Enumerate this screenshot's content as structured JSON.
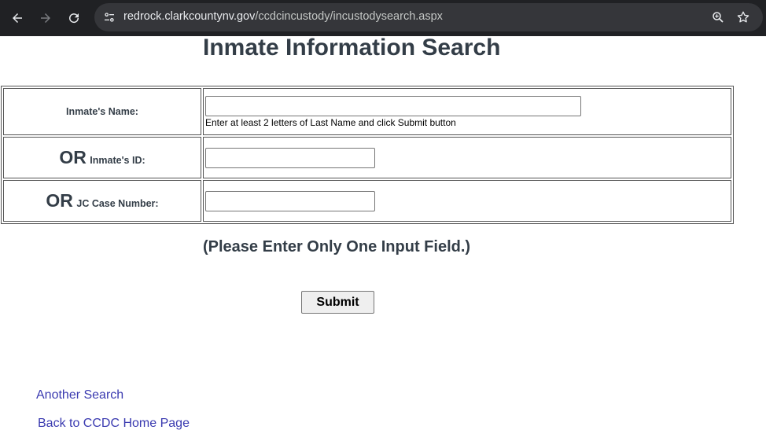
{
  "browser": {
    "url_host": "redrock.clarkcountynv.gov",
    "url_path": "/ccdcincustody/incustodysearch.aspx",
    "icons": [
      "back-icon",
      "forward-icon",
      "reload-icon",
      "site-info-icon",
      "zoom-icon",
      "bookmark-star-icon"
    ]
  },
  "page": {
    "title": "Inmate Information Search",
    "rows": {
      "name_label": "Inmate's Name:",
      "name_value": "",
      "name_hint": "Enter at least 2 letters of Last Name and click Submit button",
      "or_text": "OR",
      "id_label": "Inmate's ID:",
      "id_value": "",
      "case_label": "JC Case Number:",
      "case_value": ""
    },
    "note": "(Please Enter Only One Input Field.)",
    "submit_label": "Submit",
    "links": {
      "another_search": "Another Search",
      "home": "Back to CCDC Home Page"
    }
  },
  "colors": {
    "heading": "#333d47",
    "link": "#3a3ab0",
    "chrome_bg": "#202124",
    "omnibox_bg": "#35363a"
  }
}
